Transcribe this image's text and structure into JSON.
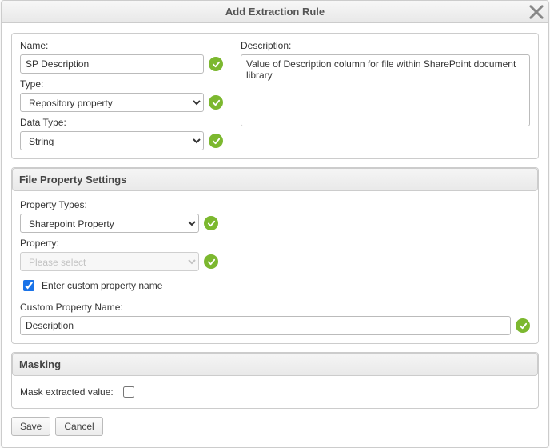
{
  "dialog": {
    "title": "Add Extraction Rule"
  },
  "fields": {
    "name_label": "Name:",
    "name_value": "SP Description",
    "type_label": "Type:",
    "type_value": "Repository property",
    "datatype_label": "Data Type:",
    "datatype_value": "String",
    "description_label": "Description:",
    "description_value": "Value of Description column for file within SharePoint document library"
  },
  "file_props": {
    "header": "File Property Settings",
    "property_types_label": "Property Types:",
    "property_types_value": "Sharepoint Property",
    "property_label": "Property:",
    "property_placeholder": "Please select",
    "enter_custom_label": "Enter custom property name",
    "enter_custom_checked": true,
    "custom_name_label": "Custom Property Name:",
    "custom_name_value": "Description"
  },
  "masking": {
    "header": "Masking",
    "mask_label": "Mask extracted value:",
    "mask_checked": false
  },
  "buttons": {
    "save": "Save",
    "cancel": "Cancel"
  }
}
